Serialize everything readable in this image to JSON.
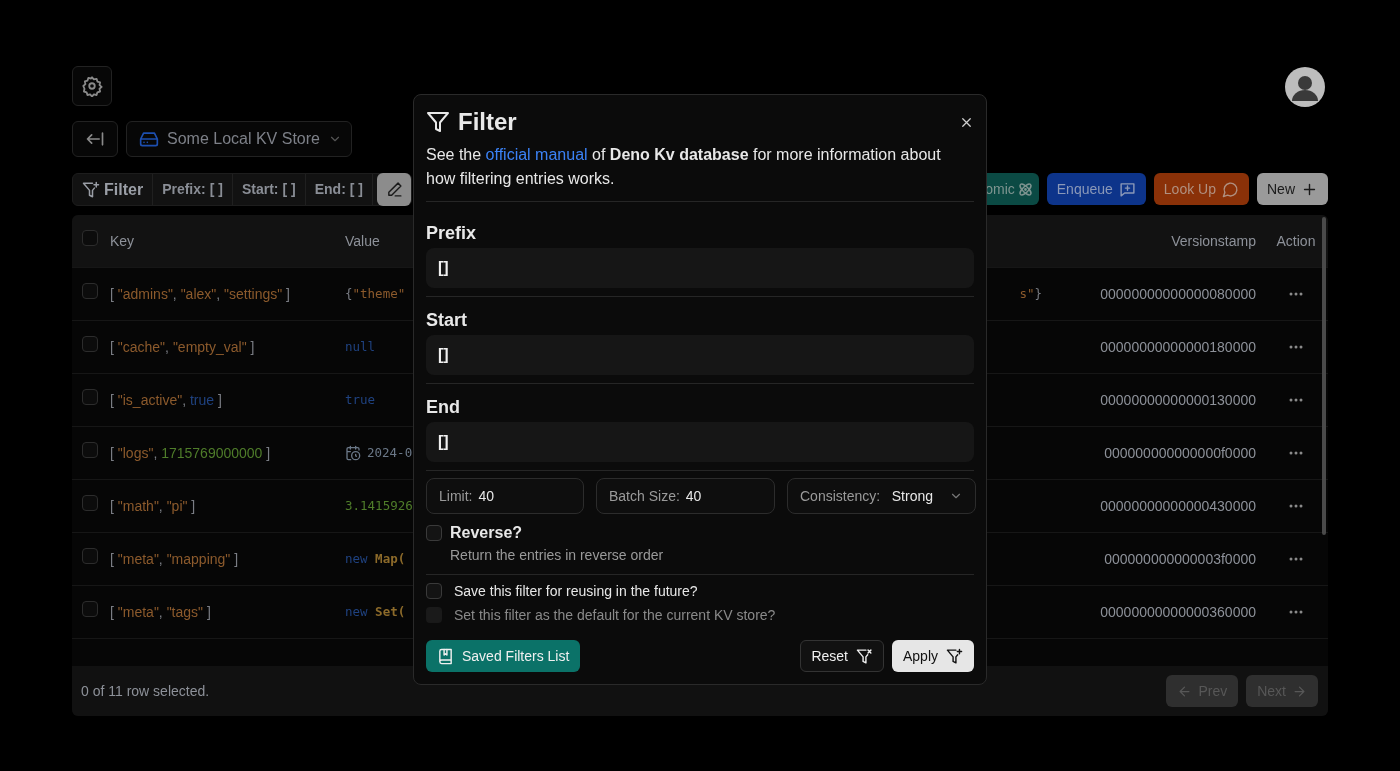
{
  "store": {
    "name": "Some Local KV Store"
  },
  "filter_bar": {
    "label": "Filter",
    "chips": [
      {
        "label": "Prefix:",
        "value": "[ ]"
      },
      {
        "label": "Start:",
        "value": "[ ]"
      },
      {
        "label": "End:",
        "value": "[ ]"
      }
    ]
  },
  "actions": [
    {
      "label": "omic",
      "kind": "atomic"
    },
    {
      "label": "Enqueue",
      "kind": "enqueue"
    },
    {
      "label": "Look Up",
      "kind": "lookup"
    },
    {
      "label": "New",
      "kind": "new"
    }
  ],
  "table": {
    "columns": [
      "Key",
      "Value",
      "Versionstamp",
      "Action"
    ],
    "all_selected": false,
    "rows": [
      {
        "selected": false,
        "key": [
          {
            "kind": "punct",
            "text": "[ "
          },
          {
            "kind": "string",
            "text": "\"admins\""
          },
          {
            "kind": "punct",
            "text": ", "
          },
          {
            "kind": "string",
            "text": "\"alex\""
          },
          {
            "kind": "punct",
            "text": ", "
          },
          {
            "kind": "string",
            "text": "\"settings\""
          },
          {
            "kind": "punct",
            "text": " ]"
          }
        ],
        "value": [
          {
            "kind": "punct",
            "text": "{"
          },
          {
            "kind": "string",
            "text": "\"theme\""
          }
        ],
        "value_tail": [
          {
            "kind": "string",
            "text": "s\""
          },
          {
            "kind": "punct",
            "text": "}"
          }
        ],
        "versionstamp": "00000000000000080000"
      },
      {
        "selected": false,
        "key": [
          {
            "kind": "punct",
            "text": "[ "
          },
          {
            "kind": "string",
            "text": "\"cache\""
          },
          {
            "kind": "punct",
            "text": ", "
          },
          {
            "kind": "string",
            "text": "\"empty_val\""
          },
          {
            "kind": "punct",
            "text": " ]"
          }
        ],
        "value": [
          {
            "kind": "keyword",
            "text": "null"
          }
        ],
        "versionstamp": "00000000000000180000"
      },
      {
        "selected": false,
        "key": [
          {
            "kind": "punct",
            "text": "[ "
          },
          {
            "kind": "string",
            "text": "\"is_active\""
          },
          {
            "kind": "punct",
            "text": ", "
          },
          {
            "kind": "keyword",
            "text": "true"
          },
          {
            "kind": "punct",
            "text": " ]"
          }
        ],
        "value": [
          {
            "kind": "keyword",
            "text": "true"
          }
        ],
        "versionstamp": "00000000000000130000"
      },
      {
        "selected": false,
        "key": [
          {
            "kind": "punct",
            "text": "[ "
          },
          {
            "kind": "string",
            "text": "\"logs\""
          },
          {
            "kind": "punct",
            "text": ", "
          },
          {
            "kind": "number",
            "text": "1715769000000"
          },
          {
            "kind": "punct",
            "text": " ]"
          }
        ],
        "value": [
          {
            "kind": "date",
            "text": "2024-0"
          }
        ],
        "versionstamp": "000000000000000f0000"
      },
      {
        "selected": false,
        "key": [
          {
            "kind": "punct",
            "text": "[ "
          },
          {
            "kind": "string",
            "text": "\"math\""
          },
          {
            "kind": "punct",
            "text": ", "
          },
          {
            "kind": "string",
            "text": "\"pi\""
          },
          {
            "kind": "punct",
            "text": " ]"
          }
        ],
        "value": [
          {
            "kind": "number",
            "text": "3.1415926"
          }
        ],
        "versionstamp": "00000000000000430000"
      },
      {
        "selected": false,
        "key": [
          {
            "kind": "punct",
            "text": "[ "
          },
          {
            "kind": "string",
            "text": "\"meta\""
          },
          {
            "kind": "punct",
            "text": ", "
          },
          {
            "kind": "string",
            "text": "\"mapping\""
          },
          {
            "kind": "punct",
            "text": " ]"
          }
        ],
        "value": [
          {
            "kind": "keyword",
            "text": "new "
          },
          {
            "kind": "class",
            "text": "Map("
          }
        ],
        "versionstamp": "000000000000003f0000"
      },
      {
        "selected": false,
        "key": [
          {
            "kind": "punct",
            "text": "[ "
          },
          {
            "kind": "string",
            "text": "\"meta\""
          },
          {
            "kind": "punct",
            "text": ", "
          },
          {
            "kind": "string",
            "text": "\"tags\""
          },
          {
            "kind": "punct",
            "text": " ]"
          }
        ],
        "value": [
          {
            "kind": "keyword",
            "text": "new "
          },
          {
            "kind": "class",
            "text": "Set("
          }
        ],
        "versionstamp": "00000000000000360000"
      }
    ]
  },
  "footer": {
    "selection": "0 of 11 row selected.",
    "pager": [
      {
        "label": "Prev",
        "kind": "prev",
        "disabled": true
      },
      {
        "label": "Next",
        "kind": "next",
        "disabled": true
      }
    ]
  },
  "modal": {
    "title": "Filter",
    "description": {
      "before": "See the ",
      "link": "official manual",
      "after": " of **Deno Kv database** for more information about how filtering entries works."
    },
    "fields": [
      {
        "label": "Prefix",
        "value": "[]"
      },
      {
        "label": "Start",
        "value": "[]"
      },
      {
        "label": "End",
        "value": "[]"
      }
    ],
    "options": [
      {
        "label": "Limit:",
        "value": "40",
        "kind": "input"
      },
      {
        "label": "Batch Size:",
        "value": "40",
        "kind": "input"
      },
      {
        "label": "Consistency:",
        "value": "Strong",
        "kind": "select"
      }
    ],
    "reverse": {
      "label": "Reverse?",
      "hint": "Return the entries in reverse order",
      "checked": false
    },
    "save_options": [
      {
        "label": "Save this filter for reusing in the future?",
        "checked": false,
        "disabled": false
      },
      {
        "label": "Set this filter as the default for the current KV store?",
        "checked": false,
        "disabled": true
      }
    ],
    "buttons": [
      {
        "label": "Saved Filters List",
        "kind": "saved"
      },
      {
        "label": "Reset",
        "kind": "reset"
      },
      {
        "label": "Apply",
        "kind": "apply"
      }
    ]
  }
}
